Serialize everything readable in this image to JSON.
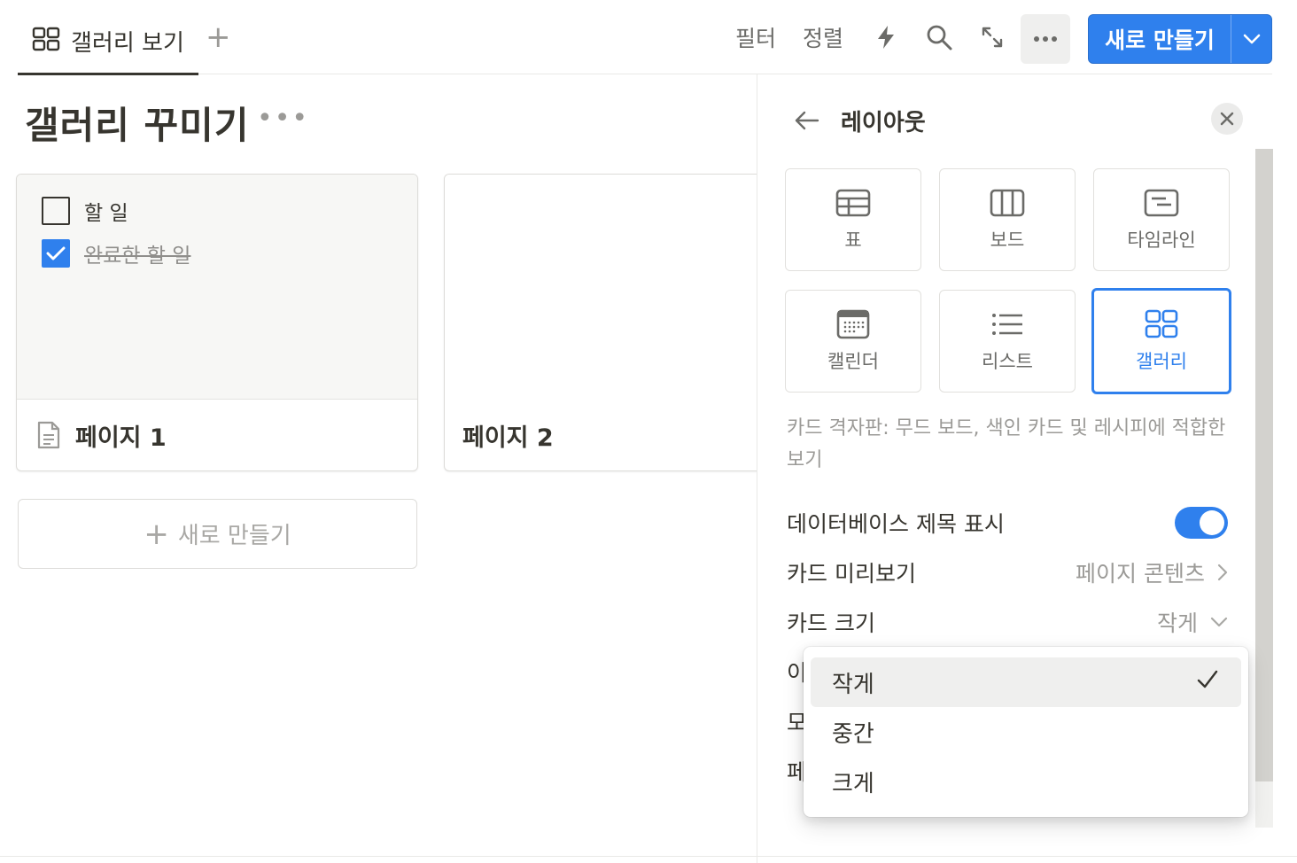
{
  "topbar": {
    "view_tab_label": "갤러리 보기",
    "add_view": "+",
    "filter_label": "필터",
    "sort_label": "정렬",
    "more_label": "•••",
    "new_label": "새로 만들기"
  },
  "page": {
    "title": "갤러리 꾸미기",
    "title_more": "•••"
  },
  "cards": [
    {
      "title": "페이지 1",
      "todos": [
        {
          "text": "할 일",
          "checked": false
        },
        {
          "text": "완료한 할 일",
          "checked": true
        }
      ]
    },
    {
      "title": "페이지 2"
    }
  ],
  "new_card_label": "새로 만들기",
  "new_card_plus": "+",
  "panel": {
    "title": "레이아웃",
    "layouts": [
      {
        "label": "표",
        "icon": "table-icon"
      },
      {
        "label": "보드",
        "icon": "board-icon"
      },
      {
        "label": "타임라인",
        "icon": "timeline-icon"
      },
      {
        "label": "캘린더",
        "icon": "calendar-icon"
      },
      {
        "label": "리스트",
        "icon": "list-icon"
      },
      {
        "label": "갤러리",
        "icon": "gallery-icon",
        "active": true
      }
    ],
    "description": "카드 격자판: 무드 보드, 색인 카드 및 레시피에 적합한 보기",
    "settings": {
      "show_db_title_label": "데이터베이스 제목 표시",
      "show_db_title_on": true,
      "card_preview_label": "카드 미리보기",
      "card_preview_value": "페이지 콘텐츠",
      "card_size_label": "카드 크기",
      "card_size_value": "작게",
      "partial_1": "이",
      "partial_2": "모",
      "partial_3": "페"
    }
  },
  "dropdown": {
    "options": [
      "작게",
      "중간",
      "크게"
    ],
    "selected": "작게",
    "check": "✓"
  },
  "colors": {
    "accent": "#2f80ed",
    "text": "#37352f",
    "muted": "#9b9a97"
  }
}
